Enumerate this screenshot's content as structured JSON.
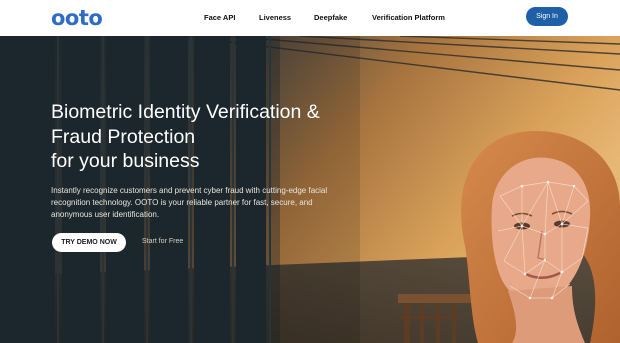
{
  "header": {
    "logo_text": "ooto",
    "nav": [
      {
        "label": "Face API"
      },
      {
        "label": "Liveness"
      },
      {
        "label": "Deepfake"
      },
      {
        "label": "Verification Platform"
      }
    ],
    "sign_in_label": "Sign In"
  },
  "hero": {
    "headline_lines": [
      "Biometric Identity Verification &",
      "Fraud Protection",
      "for your business"
    ],
    "subtext": "Instantly recognize customers and prevent cyber fraud with cutting-edge facial recognition technology. OOTO is your reliable partner for fast, secure, and anonymous user identification.",
    "primary_button": "TRY DEMO NOW",
    "secondary_link": "Start for Free"
  },
  "colors": {
    "brand": "#2f6cc6",
    "sign_in_bg": "#1e5fa8",
    "hero_dark": "#22323a",
    "hero_warm": "#c98a45"
  },
  "illustration": {
    "icon": "woman-face-scan-illustration"
  }
}
